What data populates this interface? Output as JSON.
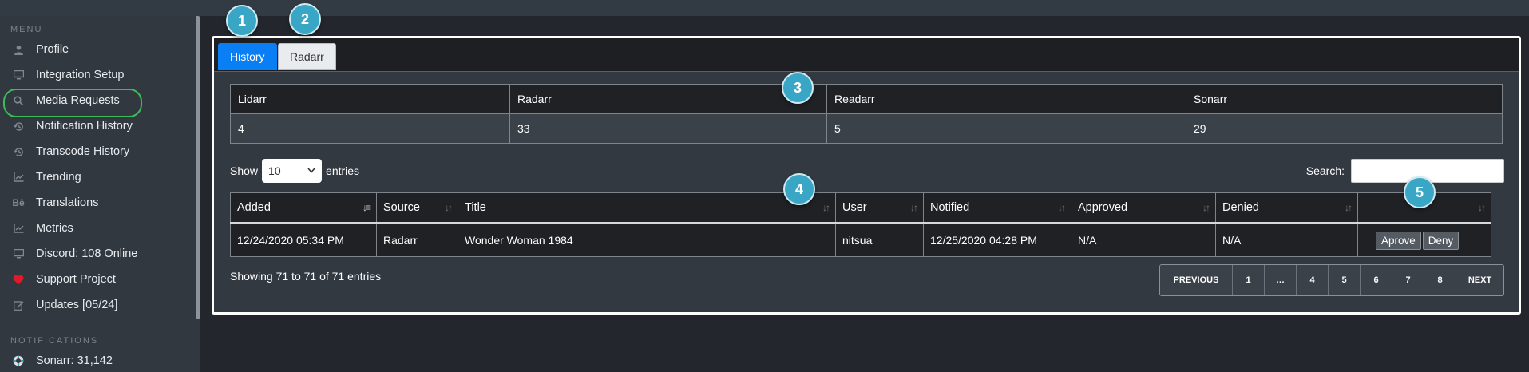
{
  "sidebar": {
    "menu_header": "MENU",
    "items": [
      {
        "label": "Profile",
        "icon": "user-icon"
      },
      {
        "label": "Integration Setup",
        "icon": "display-icon"
      },
      {
        "label": "Media Requests",
        "icon": "search-icon"
      },
      {
        "label": "Notification History",
        "icon": "history-icon"
      },
      {
        "label": "Transcode History",
        "icon": "history-icon"
      },
      {
        "label": "Trending",
        "icon": "chart-icon"
      },
      {
        "label": "Translations",
        "icon": "translate-icon"
      },
      {
        "label": "Metrics",
        "icon": "chart-icon"
      },
      {
        "label": "Discord: 108 Online",
        "icon": "discord-icon"
      },
      {
        "label": "Support Project",
        "icon": "heart-icon"
      },
      {
        "label": "Updates [05/24]",
        "icon": "edit-icon"
      }
    ],
    "notifications_header": "NOTIFICATIONS",
    "notification_items": [
      {
        "label": "Sonarr: 31,142",
        "icon": "lifebuoy-icon"
      }
    ]
  },
  "callouts": [
    "1",
    "2",
    "3",
    "4",
    "5"
  ],
  "tabs": [
    "History",
    "Radarr"
  ],
  "counts": {
    "headers": [
      "Lidarr",
      "Radarr",
      "Readarr",
      "Sonarr"
    ],
    "values": [
      "4",
      "33",
      "5",
      "29"
    ]
  },
  "table_controls": {
    "show_label": "Show",
    "entries_value": "10",
    "entries_label": "entries",
    "search_label": "Search:",
    "search_value": ""
  },
  "requests": {
    "columns": [
      "Added",
      "Source",
      "Title",
      "User",
      "Notified",
      "Approved",
      "Denied",
      ""
    ],
    "rows": [
      {
        "added": "12/24/2020 05:34 PM",
        "source": "Radarr",
        "title": "Wonder Woman 1984",
        "user": "nitsua",
        "notified": "12/25/2020 04:28 PM",
        "approved": "N/A",
        "denied": "N/A",
        "approve_label": "Aprove",
        "deny_label": "Deny"
      }
    ]
  },
  "info": "Showing 71 to 71 of 71 entries",
  "pagination": {
    "previous": "PREVIOUS",
    "pages": [
      "1",
      "…",
      "4",
      "5",
      "6",
      "7",
      "8"
    ],
    "next": "NEXT"
  },
  "colors": {
    "accent_tab": "#0a7ff5",
    "callout": "#3aa6c6",
    "highlight_ring": "#3dbb58",
    "heart": "#e0192b"
  }
}
